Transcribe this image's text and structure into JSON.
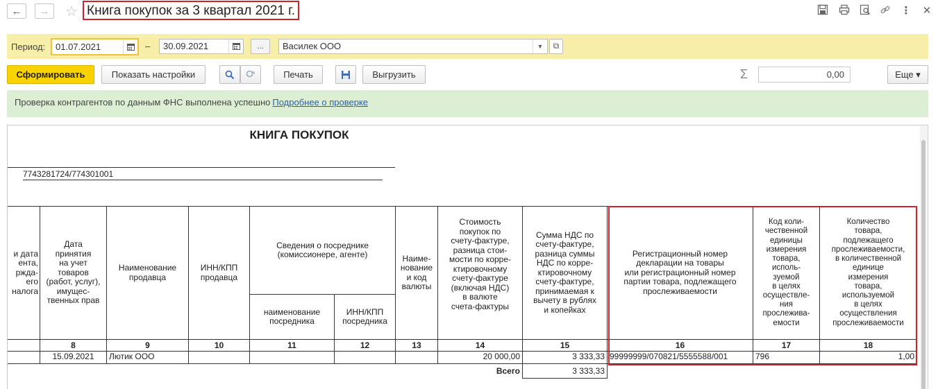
{
  "title": "Книга покупок за 3 квартал 2021 г.",
  "nav": {
    "back_icon": "←",
    "forward_icon": "→",
    "star_icon": "☆"
  },
  "toolbar_icons": {
    "save": "💾",
    "print": "🖶",
    "preview": "🔍",
    "link": "🔗",
    "more": "⋮",
    "close": "✕"
  },
  "filters": {
    "period_label": "Период:",
    "date_from": "01.07.2021",
    "date_sep": "–",
    "date_to": "30.09.2021",
    "ellipsis": "...",
    "organization": "Василек ООО"
  },
  "actions": {
    "generate": "Сформировать",
    "show_settings": "Показать настройки",
    "print": "Печать",
    "export": "Выгрузить",
    "sigma": "Σ",
    "sum_value": "0,00",
    "more": "Еще ▾"
  },
  "message": {
    "text": "Проверка контрагентов по данным ФНС выполнена успешно",
    "link": "Подробнее о проверке"
  },
  "report": {
    "title": "КНИГА ПОКУПОК",
    "inn_kpp": "7743281724/774301001",
    "headers": {
      "col7": "и дата\nента,\nржда-\nего\nналога",
      "col8": "Дата\nпринятия\nна учет\nтоваров\n(работ, услуг),\nимущес-\nтвенных прав",
      "col9": "Наименование\nпродавца",
      "col10": "ИНН/КПП\nпродавца",
      "intermediary": "Сведения о посреднике\n(комиссионере, агенте)",
      "col11": "наименование\nпосредника",
      "col12": "ИНН/КПП\nпосредника",
      "col13": "Наиме-\nнование\nи код\nвалюты",
      "col14": "Стоимость\nпокупок по\nсчету-фактуре,\nразница стои-\nмости по корре-\nктировочному\nсчету-фактуре\n(включая НДС)\nв валюте\nсчета-фактуры",
      "col15": "Сумма НДС по\nсчету-фактуре,\nразница суммы\nНДС по корре-\nктировочному\nсчету-фактуре,\nпринимаемая к\nвычету в рублях\nи копейках",
      "col16": "Регистрационный номер\nдекларации на товары\nили регистрационный номер\nпартии товара, подлежащего\nпрослеживаемости",
      "col17": "Код коли-\nчественной\nединицы\nизмерения\nтовара,\nисполь-\nзуемой\nв целях\nосуществле-\nния\nпрослежива-\nемости",
      "col18": "Количество\nтовара,\nподлежащего\nпрослеживаемости,\nв количественной\nединице\nизмерения\nтовара,\nиспользуемой\nв целях\nосуществления\nпрослеживаемости"
    },
    "col_numbers": [
      "8",
      "9",
      "10",
      "11",
      "12",
      "13",
      "14",
      "15",
      "16",
      "17",
      "18"
    ],
    "row": {
      "date": "15.09.2021",
      "seller": "Лютик ООО",
      "cost": "20 000,00",
      "vat": "3 333,33",
      "declaration": "99999999/070821/5555588/001",
      "unit_code": "796",
      "quantity": "1,00"
    },
    "total_label": "Всего",
    "total_value": "3 333,33"
  }
}
